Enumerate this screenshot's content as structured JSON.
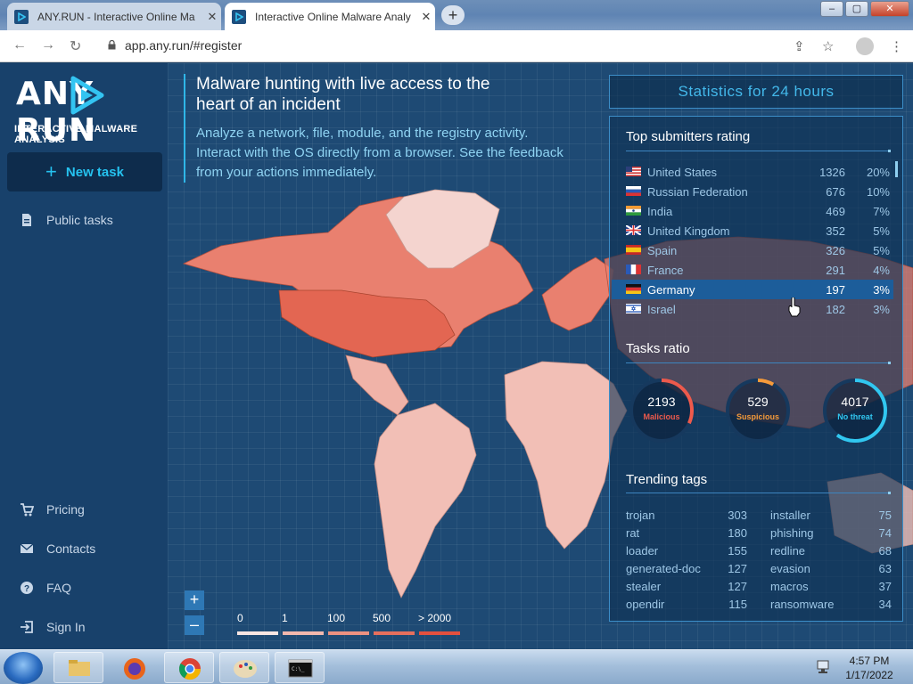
{
  "browser": {
    "tabs": [
      {
        "title": "ANY.RUN - Interactive Online Ma",
        "close": "✕"
      },
      {
        "title": "Interactive Online Malware Analy",
        "close": "✕"
      }
    ],
    "new_tab": "+",
    "url": "app.any.run/#register",
    "window_buttons": {
      "minimize": "–",
      "maximize": "▢",
      "close": "✕"
    }
  },
  "sidebar": {
    "logo_left": "ANY",
    "logo_right": "RUN",
    "logo_sub": "INTERACTIVE MALWARE ANALYSIS",
    "new_task": {
      "icon": "+",
      "label": "New task"
    },
    "public_tasks": "Public tasks",
    "pricing": "Pricing",
    "contacts": "Contacts",
    "faq": "FAQ",
    "sign_in": "Sign In"
  },
  "hero": {
    "headline": "Malware hunting with live access to the heart of an incident",
    "subtext": "Analyze a network, file, module, and the registry activity. Interact with the OS directly from a browser. See the feedback from your actions immediately."
  },
  "map": {
    "zoom_in": "+",
    "zoom_out": "–",
    "legend": [
      "0",
      "1",
      "100",
      "500",
      "> 2000"
    ],
    "legend_colors": [
      "#f7e5e2",
      "#f2b7ad",
      "#ec9181",
      "#e56f5d",
      "#e2503f"
    ]
  },
  "stats": {
    "title": "Statistics for 24 hours",
    "submitters_title": "Top submitters rating",
    "submitters": [
      {
        "country": "United States",
        "count": "1326",
        "pct": "20%"
      },
      {
        "country": "Russian Federation",
        "count": "676",
        "pct": "10%"
      },
      {
        "country": "India",
        "count": "469",
        "pct": "7%"
      },
      {
        "country": "United Kingdom",
        "count": "352",
        "pct": "5%"
      },
      {
        "country": "Spain",
        "count": "326",
        "pct": "5%"
      },
      {
        "country": "France",
        "count": "291",
        "pct": "4%"
      },
      {
        "country": "Germany",
        "count": "197",
        "pct": "3%"
      },
      {
        "country": "Israel",
        "count": "182",
        "pct": "3%"
      }
    ],
    "tasks_title": "Tasks ratio",
    "tasks": [
      {
        "count": "2193",
        "label": "Malicious",
        "color": "#ee5a4c"
      },
      {
        "count": "529",
        "label": "Suspicious",
        "color": "#f59a3a"
      },
      {
        "count": "4017",
        "label": "No threat",
        "color": "#31c7f0"
      }
    ],
    "tags_title": "Trending tags",
    "tags_left": [
      {
        "name": "trojan",
        "count": "303"
      },
      {
        "name": "rat",
        "count": "180"
      },
      {
        "name": "loader",
        "count": "155"
      },
      {
        "name": "generated-doc",
        "count": "127"
      },
      {
        "name": "stealer",
        "count": "127"
      },
      {
        "name": "opendir",
        "count": "115"
      }
    ],
    "tags_right": [
      {
        "name": "installer",
        "count": "75"
      },
      {
        "name": "phishing",
        "count": "74"
      },
      {
        "name": "redline",
        "count": "68"
      },
      {
        "name": "evasion",
        "count": "63"
      },
      {
        "name": "macros",
        "count": "37"
      },
      {
        "name": "ransomware",
        "count": "34"
      }
    ]
  },
  "taskbar": {
    "time": "4:57 PM",
    "date": "1/17/2022"
  }
}
